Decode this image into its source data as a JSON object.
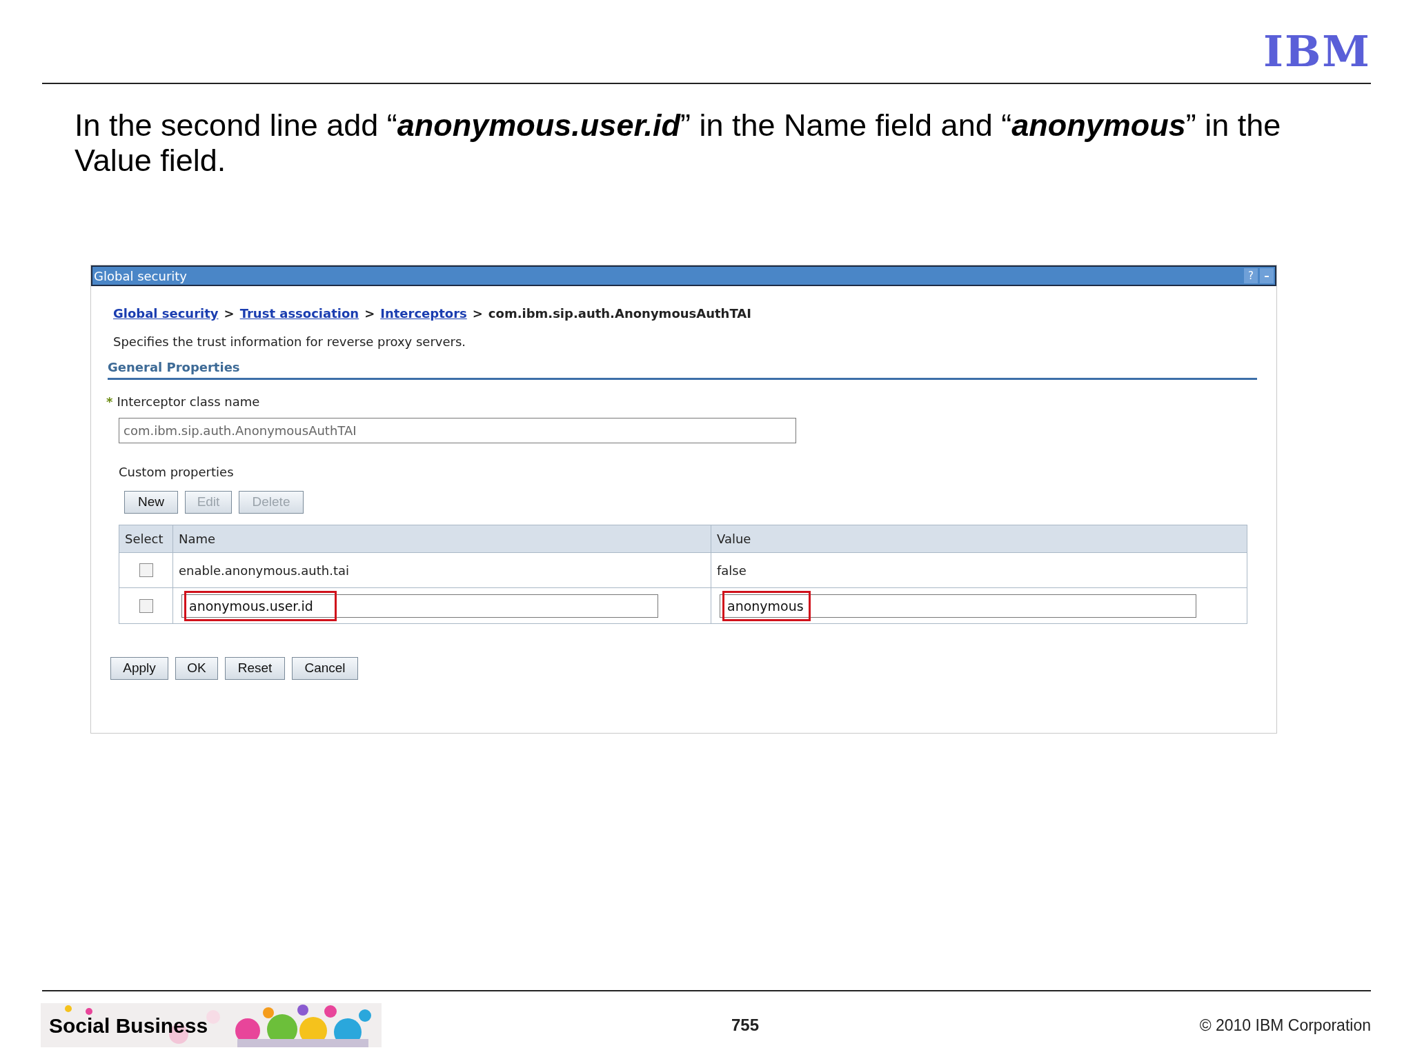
{
  "logo": "IBM",
  "instruction": [
    {
      "text": "In the second line add “",
      "emphasis": false
    },
    {
      "text": "anonymous.user.id",
      "emphasis": true
    },
    {
      "text": "” in the Name field and “",
      "emphasis": false
    },
    {
      "text": "anonymous",
      "emphasis": true
    },
    {
      "text": "” in the Value field.",
      "emphasis": false
    }
  ],
  "window": {
    "title": "Global security",
    "help": "?",
    "minimize": "–"
  },
  "breadcrumb": {
    "links": [
      "Global security",
      "Trust association",
      "Interceptors"
    ],
    "separator": ">",
    "current": "com.ibm.sip.auth.AnonymousAuthTAI"
  },
  "description": "Specifies the trust information for reverse proxy servers.",
  "section_title": "General Properties",
  "interceptor": {
    "required_mark": "*",
    "label": "Interceptor class name",
    "value": "com.ibm.sip.auth.AnonymousAuthTAI"
  },
  "custom_properties": {
    "label": "Custom properties",
    "buttons": [
      {
        "label": "New",
        "disabled": false
      },
      {
        "label": "Edit",
        "disabled": true
      },
      {
        "label": "Delete",
        "disabled": true
      }
    ],
    "columns": [
      "Select",
      "Name",
      "Value"
    ],
    "rows": [
      {
        "kind": "text",
        "checked": false,
        "name": "enable.anonymous.auth.tai",
        "value": "false"
      },
      {
        "kind": "input",
        "checked": false,
        "name": "anonymous.user.id",
        "value": "anonymous",
        "highlighted": true
      }
    ]
  },
  "actions": [
    {
      "label": "Apply"
    },
    {
      "label": "OK"
    },
    {
      "label": "Reset"
    },
    {
      "label": "Cancel"
    }
  ],
  "footer": {
    "brand": "Social Business",
    "page": "755",
    "copyright": "© 2010 IBM Corporation"
  }
}
